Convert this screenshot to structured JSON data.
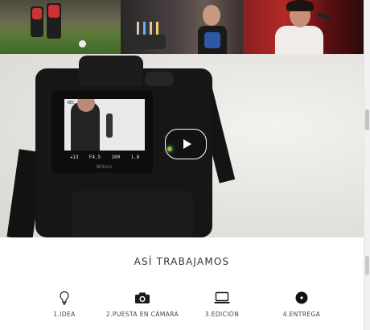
{
  "gallery": {
    "photos": [
      {
        "icon": "soccer-photo"
      },
      {
        "icon": "birthday-photo"
      },
      {
        "icon": "singer-photo"
      }
    ]
  },
  "video": {
    "screen_rec": "REC",
    "screen_info": [
      "◂13",
      "F4.5",
      "100",
      "1.8"
    ],
    "brand": "Nikon",
    "play_icon": "play-icon"
  },
  "how": {
    "title": "ASÍ TRABAJAMOS",
    "steps": [
      {
        "label": "1.IDEA",
        "icon": "lightbulb-icon"
      },
      {
        "label": "2.PUESTA EN CÁMARA",
        "icon": "camera-icon"
      },
      {
        "label": "3.EDICIÓN",
        "icon": "laptop-icon"
      },
      {
        "label": "4.ENTREGA",
        "icon": "disc-icon"
      }
    ]
  },
  "colors": {
    "background": "#ffffff",
    "text": "#333333",
    "photo3_red": "#b32a26"
  }
}
